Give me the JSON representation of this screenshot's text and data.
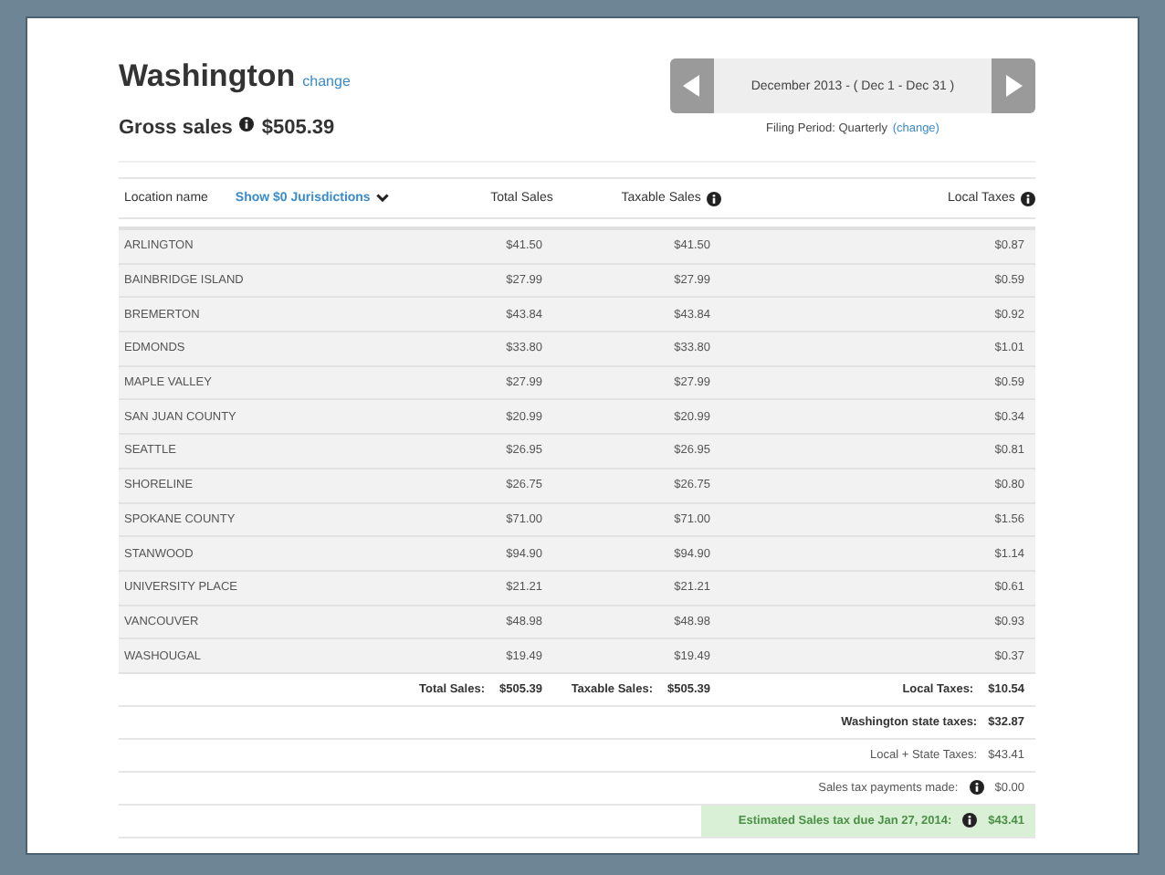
{
  "header": {
    "state": "Washington",
    "change_link": "change",
    "gross_label": "Gross sales",
    "gross_value": "$505.39"
  },
  "period": {
    "label": "December 2013 - ( Dec 1 - Dec 31 )",
    "filing_label": "Filing Period: Quarterly",
    "filing_link": "(change)"
  },
  "table": {
    "columns": [
      {
        "label": "Location name",
        "info": false
      },
      {
        "label": "Total Sales",
        "info": false
      },
      {
        "label": "Taxable Sales",
        "info": true
      },
      {
        "label": "Local Taxes",
        "info": true
      }
    ],
    "toggle": "Show $0 Jurisdictions",
    "rows": [
      {
        "location": "ARLINGTON",
        "total": "$41.50",
        "taxable": "$41.50",
        "local": "$0.87"
      },
      {
        "location": "BAINBRIDGE ISLAND",
        "total": "$27.99",
        "taxable": "$27.99",
        "local": "$0.59"
      },
      {
        "location": "BREMERTON",
        "total": "$43.84",
        "taxable": "$43.84",
        "local": "$0.92"
      },
      {
        "location": "EDMONDS",
        "total": "$33.80",
        "taxable": "$33.80",
        "local": "$1.01"
      },
      {
        "location": "MAPLE VALLEY",
        "total": "$27.99",
        "taxable": "$27.99",
        "local": "$0.59"
      },
      {
        "location": "SAN JUAN COUNTY",
        "total": "$20.99",
        "taxable": "$20.99",
        "local": "$0.34"
      },
      {
        "location": "SEATTLE",
        "total": "$26.95",
        "taxable": "$26.95",
        "local": "$0.81"
      },
      {
        "location": "SHORELINE",
        "total": "$26.75",
        "taxable": "$26.75",
        "local": "$0.80"
      },
      {
        "location": "SPOKANE COUNTY",
        "total": "$71.00",
        "taxable": "$71.00",
        "local": "$1.56"
      },
      {
        "location": "STANWOOD",
        "total": "$94.90",
        "taxable": "$94.90",
        "local": "$1.14"
      },
      {
        "location": "UNIVERSITY PLACE",
        "total": "$21.21",
        "taxable": "$21.21",
        "local": "$0.61"
      },
      {
        "location": "VANCOUVER",
        "total": "$48.98",
        "taxable": "$48.98",
        "local": "$0.93"
      },
      {
        "location": "WASHOUGAL",
        "total": "$19.49",
        "taxable": "$19.49",
        "local": "$0.37"
      }
    ],
    "totals": {
      "total_label": "Total Sales:",
      "total_value": "$505.39",
      "taxable_label": "Taxable Sales:",
      "taxable_value": "$505.39",
      "local_label": "Local Taxes:",
      "local_value": "$10.54"
    }
  },
  "summary": [
    {
      "kind": "bold",
      "label": "Washington state taxes:",
      "value": "$32.87",
      "info": false
    },
    {
      "kind": "plain",
      "label": "Local + State Taxes:",
      "value": "$43.41",
      "info": false
    },
    {
      "kind": "plain",
      "label": "Sales tax payments made:",
      "value": "$0.00",
      "info": true
    },
    {
      "kind": "due",
      "label": "Estimated Sales tax due Jan 27, 2014:",
      "value": "$43.41",
      "info": true
    }
  ]
}
